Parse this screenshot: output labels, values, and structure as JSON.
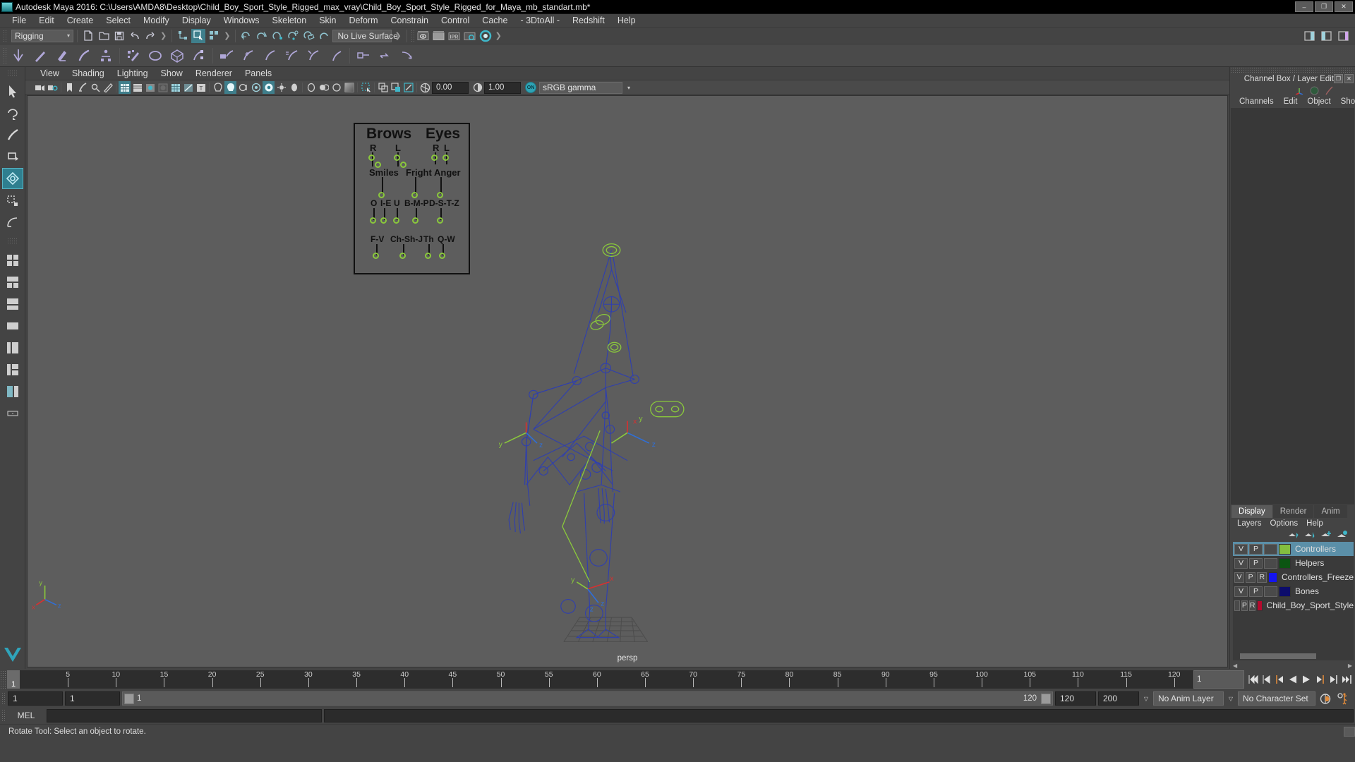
{
  "window": {
    "title": "Autodesk Maya 2016: C:\\Users\\AMDA8\\Desktop\\Child_Boy_Sport_Style_Rigged_max_vray\\Child_Boy_Sport_Style_Rigged_for_Maya_mb_standart.mb*",
    "minimize": "–",
    "maximize": "❐",
    "close": "✕"
  },
  "menubar": {
    "items": [
      "File",
      "Edit",
      "Create",
      "Select",
      "Modify",
      "Display",
      "Windows",
      "Skeleton",
      "Skin",
      "Deform",
      "Constrain",
      "Control",
      "Cache",
      "- 3DtoAll -",
      "Redshift",
      "Help"
    ]
  },
  "toolbar": {
    "menuset": "Rigging",
    "menuset_arrow": "▾",
    "live_surface": "No Live Surface",
    "ipr_label": "IPR"
  },
  "viewport_panel": {
    "menu": [
      "View",
      "Shading",
      "Lighting",
      "Show",
      "Renderer",
      "Panels"
    ],
    "exposure_value": "0.00",
    "gamma_value": "1.00",
    "color_badge": "ON",
    "color_profile": "sRGB gamma",
    "color_profile_arrow": "▾",
    "camera_label": "persp"
  },
  "face_controls": {
    "groups": [
      {
        "label": "Brows",
        "size": "h"
      },
      {
        "label": "Eyes",
        "size": "h"
      },
      {
        "label": "R",
        "size": "m"
      },
      {
        "label": "L",
        "size": "m"
      },
      {
        "label": "R",
        "size": "m"
      },
      {
        "label": "L",
        "size": "m"
      },
      {
        "label": "Smiles",
        "size": "m"
      },
      {
        "label": "Fright",
        "size": "m"
      },
      {
        "label": "Anger",
        "size": "m"
      },
      {
        "label": "O",
        "size": "s"
      },
      {
        "label": "I-E",
        "size": "s"
      },
      {
        "label": "U",
        "size": "s"
      },
      {
        "label": "B-M-P",
        "size": "s"
      },
      {
        "label": "D-S-T-Z",
        "size": "s"
      },
      {
        "label": "F-V",
        "size": "s"
      },
      {
        "label": "Ch-Sh-J",
        "size": "s"
      },
      {
        "label": "Th",
        "size": "s"
      },
      {
        "label": "Q-W",
        "size": "s"
      }
    ]
  },
  "channel_box": {
    "title": "Channel Box / Layer Editor",
    "restore": "❐",
    "close": "✕",
    "menu": [
      "Channels",
      "Edit",
      "Object",
      "Show"
    ]
  },
  "layer_editor": {
    "tabs": [
      {
        "label": "Display",
        "active": true
      },
      {
        "label": "Render",
        "active": false
      },
      {
        "label": "Anim",
        "active": false
      }
    ],
    "menu": [
      "Layers",
      "Options",
      "Help"
    ],
    "layers": [
      {
        "v": "V",
        "p": "P",
        "r": "",
        "color": "#84bf3f",
        "name": "Controllers",
        "selected": true
      },
      {
        "v": "V",
        "p": "P",
        "r": "",
        "color": "#0b5512",
        "name": "Helpers",
        "selected": false
      },
      {
        "v": "V",
        "p": "P",
        "r": "R",
        "color": "#1414f0",
        "name": "Controllers_Freeze",
        "selected": false
      },
      {
        "v": "V",
        "p": "P",
        "r": "",
        "color": "#0c0c6b",
        "name": "Bones",
        "selected": false
      },
      {
        "v": "",
        "p": "P",
        "r": "R",
        "color": "#b40a2e",
        "name": "Child_Boy_Sport_Style",
        "selected": false
      }
    ]
  },
  "timeline": {
    "current_frame": "1",
    "ticks": [
      5,
      10,
      15,
      20,
      25,
      30,
      35,
      40,
      45,
      50,
      55,
      60,
      65,
      70,
      75,
      80,
      85,
      90,
      95,
      100,
      105,
      110,
      115,
      120
    ],
    "end_field": "1"
  },
  "range": {
    "start": "1",
    "range_start": "1",
    "bar_start_label": "1",
    "bar_end_label": "120",
    "range_end": "120",
    "end": "200",
    "anim_layer": "No Anim Layer",
    "character_set": "No Character Set",
    "arrow": "▽"
  },
  "mel": {
    "label": "MEL",
    "input_value": "",
    "output_value": ""
  },
  "statusbar": {
    "message": "Rotate Tool: Select an object to rotate."
  },
  "icons": {
    "playback": [
      "go-to-start",
      "step-back-key",
      "step-back-frame",
      "play-backwards",
      "play-forwards",
      "step-forward-frame",
      "step-forward-key",
      "go-to-end"
    ]
  }
}
